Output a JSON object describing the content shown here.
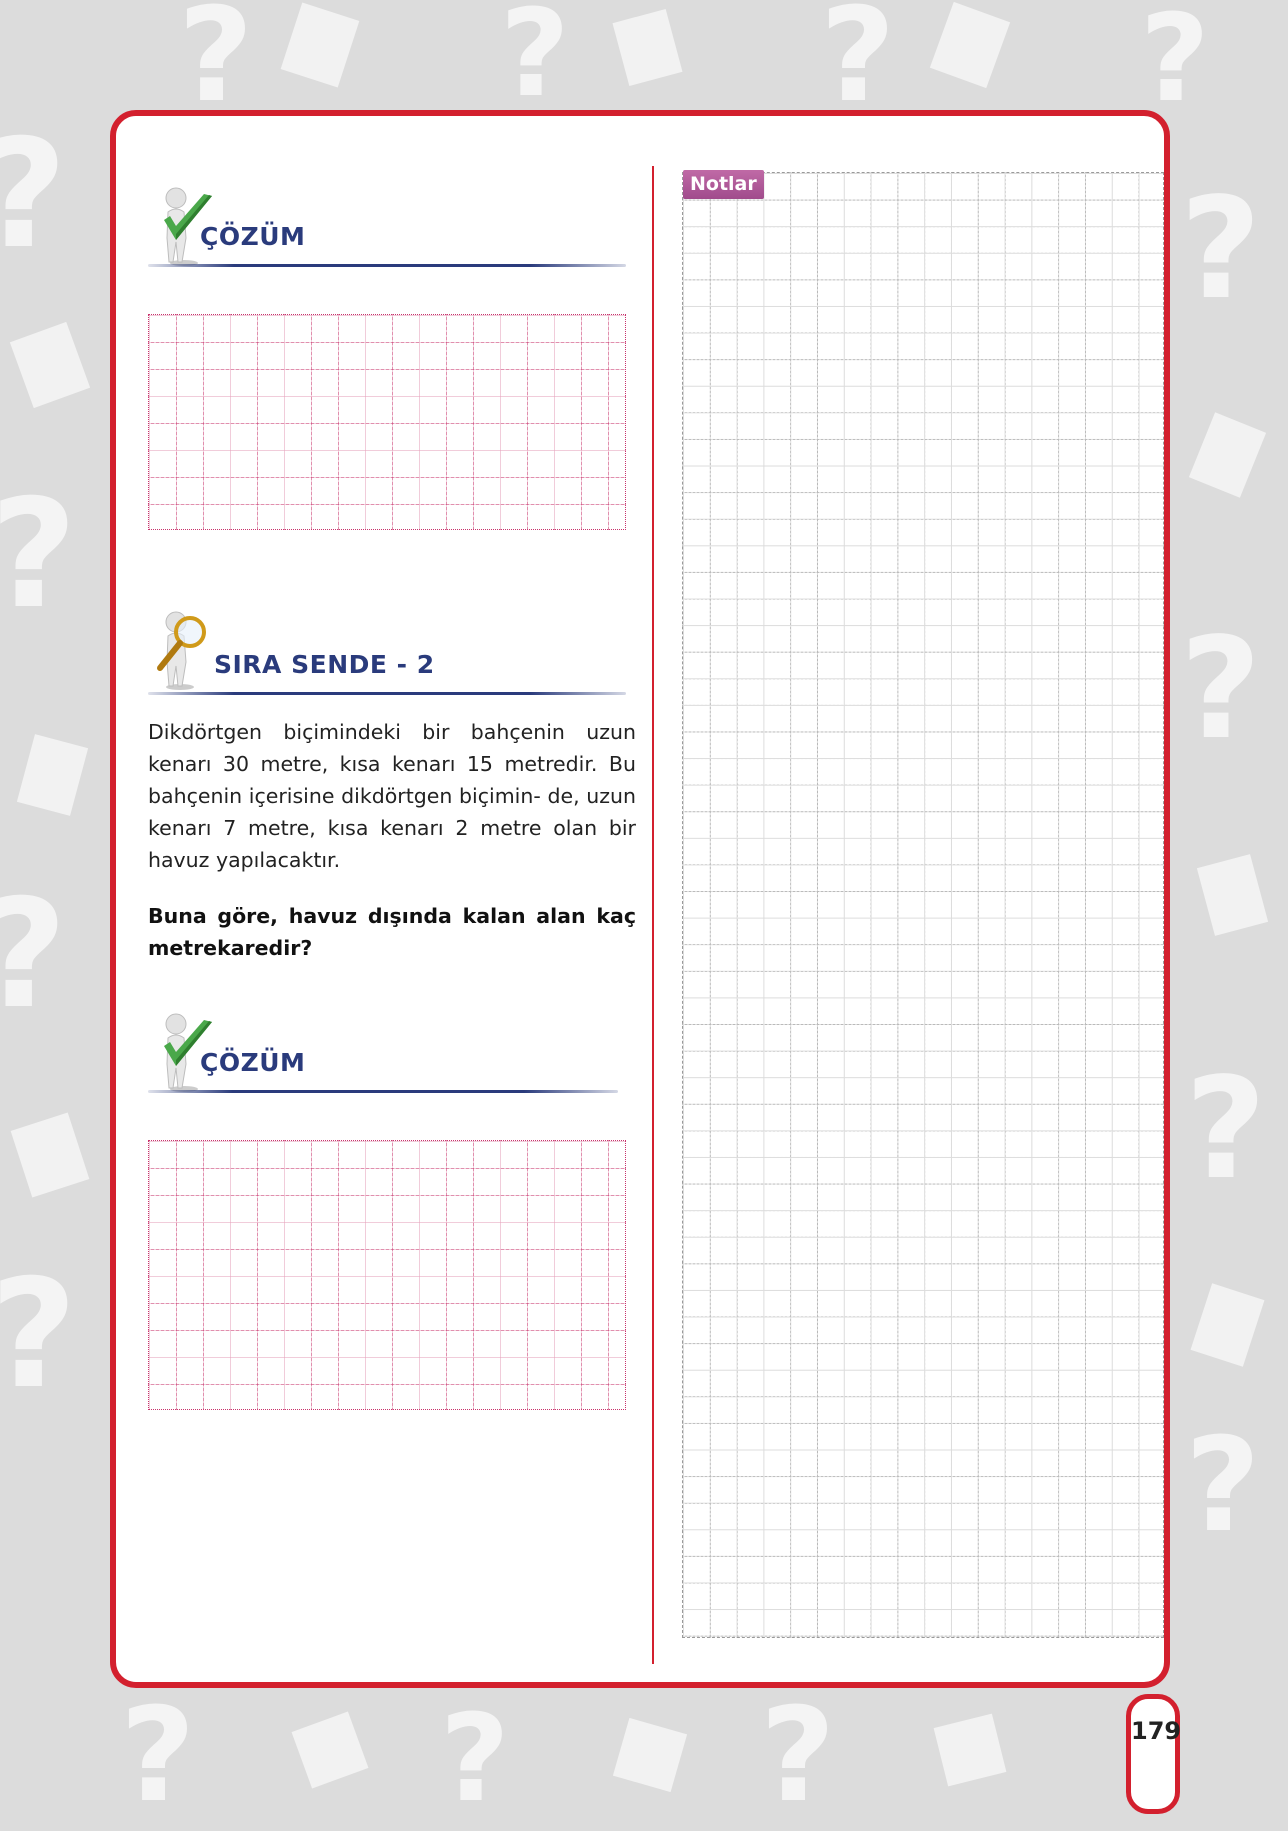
{
  "section_1": {
    "title": "ÇÖZÜM"
  },
  "section_2": {
    "title": "SIRA SENDE - 2",
    "problem_lines": [
      "Dikdörtgen biçimindeki bir bahçenin uzun",
      "kenarı 30 metre, kısa kenarı 15 metredir.",
      "Bu bahçenin içerisine dikdörtgen biçimin-",
      "de, uzun kenarı 7 metre, kısa kenarı 2 metre",
      "olan bir havuz yapılacaktır."
    ],
    "question_lines": [
      "Buna göre, havuz dışında kalan alan kaç",
      "metrekaredir?"
    ]
  },
  "section_3": {
    "title": "ÇÖZÜM"
  },
  "notes": {
    "label": "Notlar"
  },
  "page": {
    "number": "179"
  },
  "colors": {
    "frame": "#d3202e",
    "heading": "#2a3b7c",
    "notes_tag": "#b05a99",
    "grid_pink": "#c8336c"
  },
  "icons": {
    "solution": "figure-checkmark-icon",
    "your_turn": "figure-magnifier-icon"
  }
}
